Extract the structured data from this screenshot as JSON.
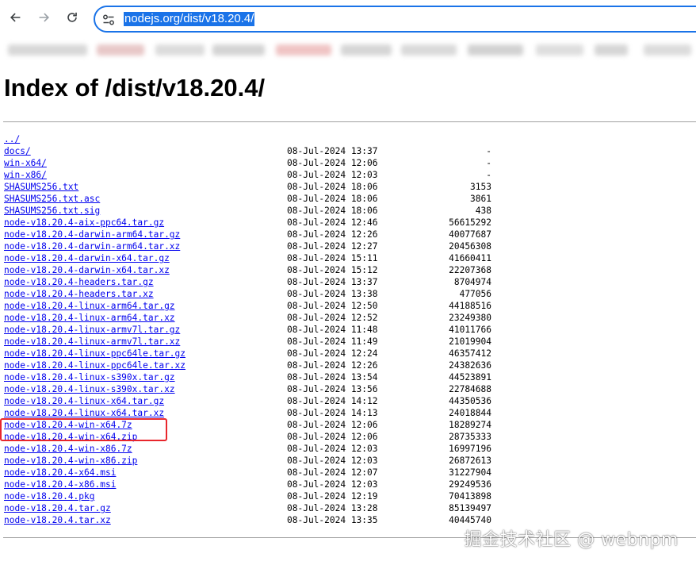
{
  "browser": {
    "url": "nodejs.org/dist/v18.20.4/",
    "back_icon": "arrow-left-icon",
    "forward_icon": "arrow-right-icon",
    "reload_icon": "reload-icon",
    "site_info_icon": "tune-icon",
    "accent_color": "#1a73e8"
  },
  "page": {
    "title": "Index of /dist/v18.20.4/",
    "link_color": "#0000ee"
  },
  "listing": [
    {
      "name": "../",
      "date": "",
      "size": ""
    },
    {
      "name": "docs/",
      "date": "08-Jul-2024 13:37",
      "size": "-"
    },
    {
      "name": "win-x64/",
      "date": "08-Jul-2024 12:06",
      "size": "-"
    },
    {
      "name": "win-x86/",
      "date": "08-Jul-2024 12:03",
      "size": "-"
    },
    {
      "name": "SHASUMS256.txt",
      "date": "08-Jul-2024 18:06",
      "size": "3153"
    },
    {
      "name": "SHASUMS256.txt.asc",
      "date": "08-Jul-2024 18:06",
      "size": "3861"
    },
    {
      "name": "SHASUMS256.txt.sig",
      "date": "08-Jul-2024 18:06",
      "size": "438"
    },
    {
      "name": "node-v18.20.4-aix-ppc64.tar.gz",
      "date": "08-Jul-2024 12:46",
      "size": "56615292"
    },
    {
      "name": "node-v18.20.4-darwin-arm64.tar.gz",
      "date": "08-Jul-2024 12:26",
      "size": "40077687"
    },
    {
      "name": "node-v18.20.4-darwin-arm64.tar.xz",
      "date": "08-Jul-2024 12:27",
      "size": "20456308"
    },
    {
      "name": "node-v18.20.4-darwin-x64.tar.gz",
      "date": "08-Jul-2024 15:11",
      "size": "41660411"
    },
    {
      "name": "node-v18.20.4-darwin-x64.tar.xz",
      "date": "08-Jul-2024 15:12",
      "size": "22207368"
    },
    {
      "name": "node-v18.20.4-headers.tar.gz",
      "date": "08-Jul-2024 13:37",
      "size": "8704974"
    },
    {
      "name": "node-v18.20.4-headers.tar.xz",
      "date": "08-Jul-2024 13:38",
      "size": "477056"
    },
    {
      "name": "node-v18.20.4-linux-arm64.tar.gz",
      "date": "08-Jul-2024 12:50",
      "size": "44188516"
    },
    {
      "name": "node-v18.20.4-linux-arm64.tar.xz",
      "date": "08-Jul-2024 12:52",
      "size": "23249380"
    },
    {
      "name": "node-v18.20.4-linux-armv7l.tar.gz",
      "date": "08-Jul-2024 11:48",
      "size": "41011766"
    },
    {
      "name": "node-v18.20.4-linux-armv7l.tar.xz",
      "date": "08-Jul-2024 11:49",
      "size": "21019904"
    },
    {
      "name": "node-v18.20.4-linux-ppc64le.tar.gz",
      "date": "08-Jul-2024 12:24",
      "size": "46357412"
    },
    {
      "name": "node-v18.20.4-linux-ppc64le.tar.xz",
      "date": "08-Jul-2024 12:26",
      "size": "24382636"
    },
    {
      "name": "node-v18.20.4-linux-s390x.tar.gz",
      "date": "08-Jul-2024 13:54",
      "size": "44523891"
    },
    {
      "name": "node-v18.20.4-linux-s390x.tar.xz",
      "date": "08-Jul-2024 13:56",
      "size": "22784688"
    },
    {
      "name": "node-v18.20.4-linux-x64.tar.gz",
      "date": "08-Jul-2024 14:12",
      "size": "44350536"
    },
    {
      "name": "node-v18.20.4-linux-x64.tar.xz",
      "date": "08-Jul-2024 14:13",
      "size": "24018844"
    },
    {
      "name": "node-v18.20.4-win-x64.7z",
      "date": "08-Jul-2024 12:06",
      "size": "18289274"
    },
    {
      "name": "node-v18.20.4-win-x64.zip",
      "date": "08-Jul-2024 12:06",
      "size": "28735333"
    },
    {
      "name": "node-v18.20.4-win-x86.7z",
      "date": "08-Jul-2024 12:03",
      "size": "16997196"
    },
    {
      "name": "node-v18.20.4-win-x86.zip",
      "date": "08-Jul-2024 12:03",
      "size": "26872613"
    },
    {
      "name": "node-v18.20.4-x64.msi",
      "date": "08-Jul-2024 12:07",
      "size": "31227904"
    },
    {
      "name": "node-v18.20.4-x86.msi",
      "date": "08-Jul-2024 12:03",
      "size": "29249536"
    },
    {
      "name": "node-v18.20.4.pkg",
      "date": "08-Jul-2024 12:19",
      "size": "70413898"
    },
    {
      "name": "node-v18.20.4.tar.gz",
      "date": "08-Jul-2024 13:28",
      "size": "85139497"
    },
    {
      "name": "node-v18.20.4.tar.xz",
      "date": "08-Jul-2024 13:35",
      "size": "40445740"
    }
  ],
  "annotation": {
    "highlight_color": "#e8262c"
  },
  "watermark": {
    "text": "掘金技术社区 @ webnpm"
  }
}
